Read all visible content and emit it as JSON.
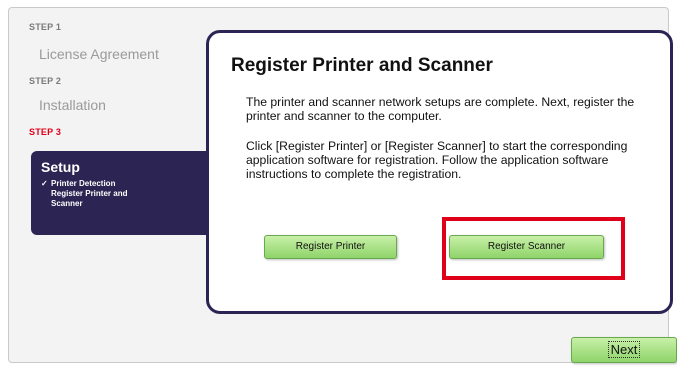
{
  "sidebar": {
    "steps": [
      {
        "label": "STEP 1",
        "title": "License Agreement"
      },
      {
        "label": "STEP 2",
        "title": "Installation"
      },
      {
        "label": "STEP 3",
        "title": "Setup"
      }
    ],
    "substeps": [
      "Printer Detection",
      "Register Printer and Scanner"
    ]
  },
  "panel": {
    "title": "Register Printer and Scanner",
    "paragraph1": "The printer and scanner network setups are complete. Next, register the printer and scanner to the computer.",
    "paragraph2": "Click [Register Printer] or [Register Scanner] to start the corresponding application software for registration. Follow the application software instructions to complete the registration."
  },
  "buttons": {
    "register_printer": "Register Printer",
    "register_scanner": "Register Scanner",
    "next": "Next"
  },
  "colors": {
    "accent_dark": "#2c2452",
    "step_active": "#e0001a",
    "button_green": "#8fd46a",
    "highlight": "#e0001a"
  }
}
